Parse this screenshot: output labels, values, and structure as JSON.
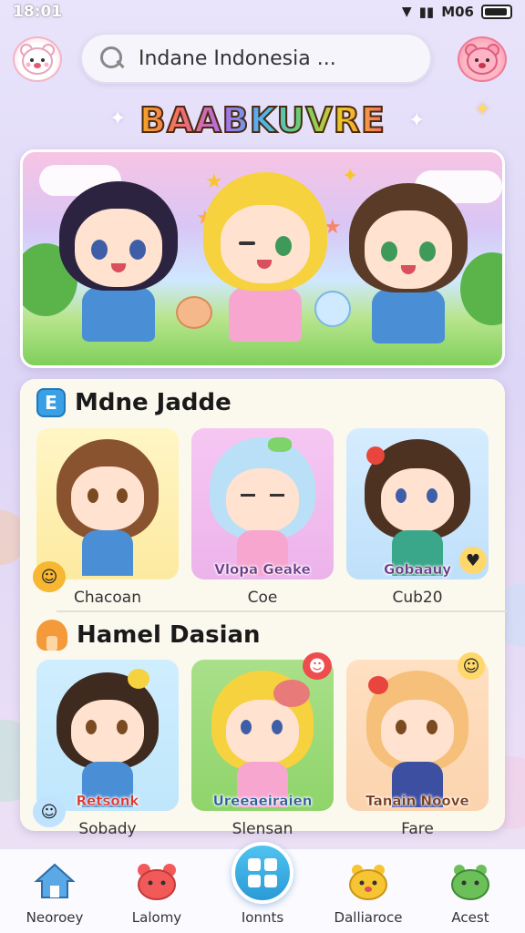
{
  "status_bar": {
    "time": "18:01",
    "carrier": "M06"
  },
  "search": {
    "value": "Indane Indonesia ..."
  },
  "logo": {
    "text": "BAABKUVRE"
  },
  "section1": {
    "title": "Mdne Jadde",
    "cards": [
      {
        "tag": "",
        "label": "Chacoan"
      },
      {
        "tag": "Vlopa Geake",
        "label": "Coe"
      },
      {
        "tag": "Gobaauy",
        "label": "Cub20"
      }
    ]
  },
  "section2": {
    "title": "Hamel Dasian",
    "cards": [
      {
        "tag": "Retsonk",
        "label": "Sobady"
      },
      {
        "tag": "Ureeaeiraien",
        "label": "Slensan"
      },
      {
        "tag": "Tanain Noove",
        "label": "Fare"
      }
    ]
  },
  "bottom_nav": [
    {
      "label": "Neoroey",
      "icon": "house-icon"
    },
    {
      "label": "Lalomy",
      "icon": "bear-icon"
    },
    {
      "label": "Ionnts",
      "icon": "grid-icon"
    },
    {
      "label": "Dalliaroce",
      "icon": "pudding-icon"
    },
    {
      "label": "Acest",
      "icon": "frog-icon"
    }
  ],
  "colors": {
    "accent": "#2a9ad6",
    "panel": "#fbf8ee",
    "background": "#e6dcf6"
  }
}
